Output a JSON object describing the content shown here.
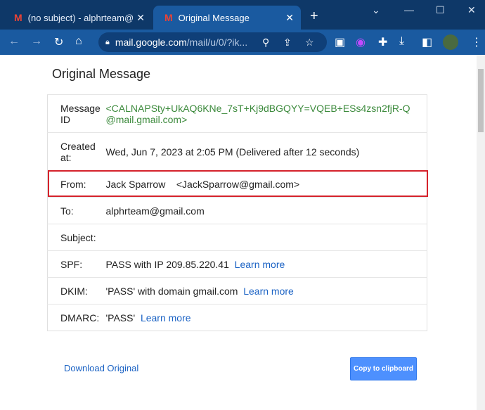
{
  "browser": {
    "tabs": [
      {
        "label": "(no subject) - alphrteam@gr",
        "icon": "gmail-icon"
      },
      {
        "label": "Original Message",
        "icon": "gmail-icon",
        "active": true
      }
    ],
    "url_host": "mail.google.com",
    "url_path": "/mail/u/0/?ik..."
  },
  "page": {
    "title": "Original Message",
    "rows": [
      {
        "label": "Message ID",
        "value": "<CALNAPSty+UkAQ6KNe_7sT+Kj9dBGQYY=VQEB+ESs4zsn2fjR-Q@mail.gmail.com>"
      },
      {
        "label": "Created at:",
        "value": "Wed, Jun 7, 2023 at 2:05 PM (Delivered after 12 seconds)"
      },
      {
        "label": "From:",
        "value": "Jack Sparrow    <JackSparrow@gmail.com>"
      },
      {
        "label": "To:",
        "value": "alphrteam@gmail.com"
      },
      {
        "label": "Subject:",
        "value": ""
      },
      {
        "label": "SPF:",
        "value": "PASS with IP 209.85.220.41",
        "link": "Learn more"
      },
      {
        "label": "DKIM:",
        "value": "'PASS' with domain gmail.com",
        "link": "Learn more"
      },
      {
        "label": "DMARC:",
        "value": "'PASS'",
        "link": "Learn more"
      }
    ],
    "download_label": "Download Original",
    "copy_label": "Copy to clipboard"
  },
  "colors": {
    "highlight": "#d5222b",
    "link": "#1a62c4",
    "message_id": "#3c8a3c"
  }
}
